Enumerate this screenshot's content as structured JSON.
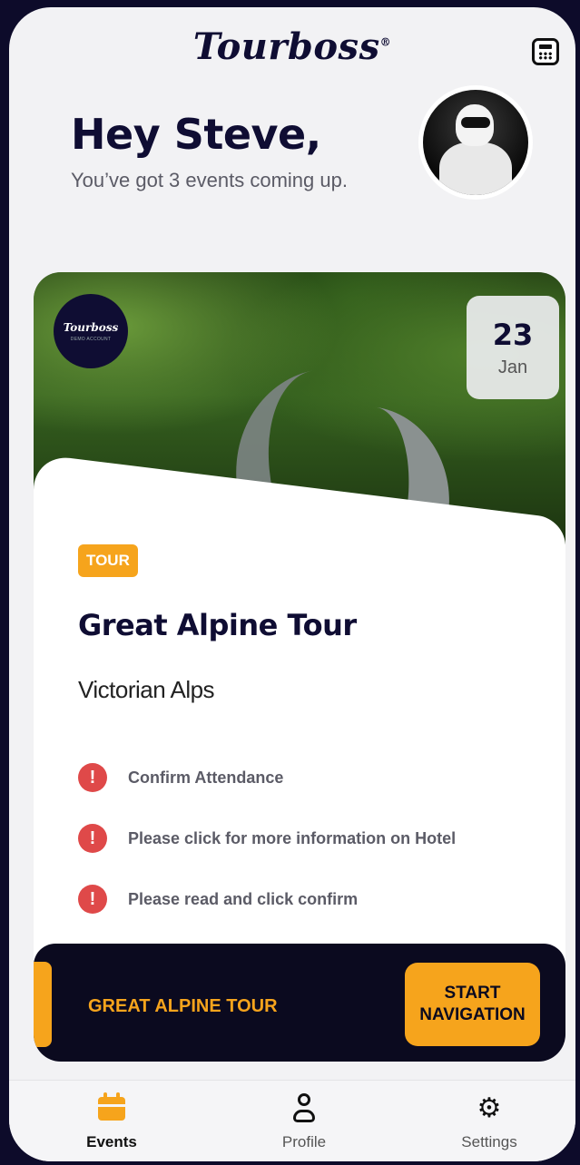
{
  "app": {
    "brand": "Tourboss",
    "brand_mark": "®"
  },
  "header": {
    "greeting": "Hey Steve,",
    "subtitle": "You’ve got 3 events coming up."
  },
  "icons": {
    "top_right": "calculator-icon",
    "avatar": "profile-avatar"
  },
  "event_card": {
    "org_badge": {
      "logo": "Tourboss",
      "subtitle": "DEMO ACCOUNT"
    },
    "date": {
      "day": "23",
      "month": "Jan"
    },
    "tag": "TOUR",
    "title": "Great Alpine Tour",
    "location": "Victorian Alps",
    "alerts": [
      {
        "text": "Confirm Attendance"
      },
      {
        "text": "Please click for more information on Hotel"
      },
      {
        "text": "Please read and click confirm"
      }
    ],
    "nav_bar": {
      "title": "GREAT ALPINE TOUR",
      "button": "START NAVIGATION"
    }
  },
  "bottom_nav": [
    {
      "label": "Events",
      "icon": "calendar-icon",
      "active": true
    },
    {
      "label": "Profile",
      "icon": "person-icon",
      "active": false
    },
    {
      "label": "Settings",
      "icon": "gear-icon",
      "active": false
    }
  ],
  "colors": {
    "accent": "#f6a41c",
    "dark": "#0f0d33",
    "alert": "#df4949",
    "background": "#0d0b2a"
  }
}
